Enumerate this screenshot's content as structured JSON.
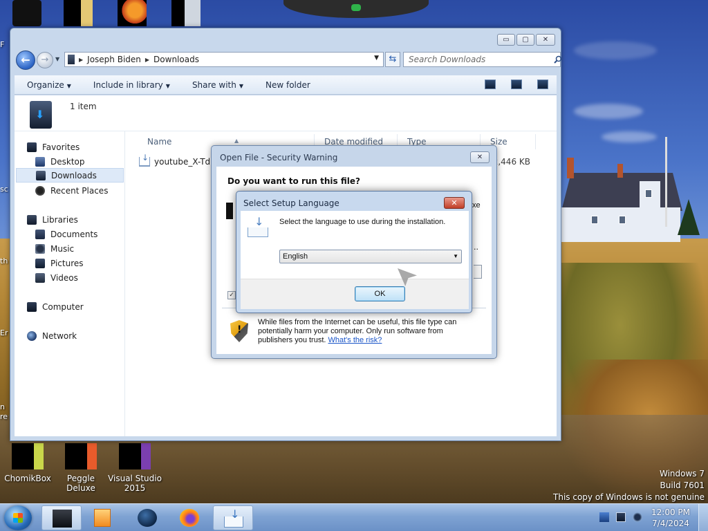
{
  "desktop": {
    "top_icons": [
      "recycle-bin-icon",
      "folder-icon",
      "media-player-icon",
      "file-icon"
    ],
    "side_fragments": [
      "F",
      "sc",
      "th",
      "Er",
      "n",
      "re"
    ],
    "icons": [
      {
        "name": "ChomikBox",
        "glyph": "chomikbox-icon"
      },
      {
        "name": "Peggle Deluxe",
        "glyph": "peggle-icon"
      },
      {
        "name": "Visual Studio 2015",
        "glyph": "visual-studio-icon"
      }
    ],
    "watermark": {
      "line1": "Windows 7",
      "line2": "Build 7601",
      "line3": "This copy of Windows is not genuine"
    }
  },
  "explorer": {
    "controls": {
      "minimize": "▭",
      "maximize": "▢",
      "close": "✕"
    },
    "address": {
      "user": "Joseph Biden",
      "folder": "Downloads"
    },
    "search": {
      "placeholder": "Search Downloads"
    },
    "toolbar": {
      "organize": "Organize",
      "include": "Include in library",
      "share": "Share with",
      "new_folder": "New folder"
    },
    "item_count": "1 item",
    "nav": {
      "favorites": "Favorites",
      "desktop": "Desktop",
      "downloads": "Downloads",
      "recent": "Recent Places",
      "libraries": "Libraries",
      "documents": "Documents",
      "music": "Music",
      "pictures": "Pictures",
      "videos": "Videos",
      "computer": "Computer",
      "network": "Network"
    },
    "columns": {
      "name": "Name",
      "date": "Date modified",
      "type": "Type",
      "size": "Size"
    },
    "file": {
      "name": "youtube_X-TdM",
      "size": "2,446 KB"
    }
  },
  "security": {
    "title": "Open File - Security Warning",
    "close": "✕",
    "question": "Do you want to run this file?",
    "frag_right": "xe",
    "frag_dots": "..",
    "checkbox": "✓",
    "warning": "While files from the Internet can be useful, this file type can potentially harm your computer. Only run software from publishers you trust.",
    "link": "What's the risk?"
  },
  "setup": {
    "title": "Select Setup Language",
    "close": "✕",
    "prompt": "Select the language to use during the installation.",
    "language": "English",
    "ok": "OK"
  },
  "taskbar": {
    "time": "12:00 PM",
    "date": "7/4/2024"
  },
  "colors": {
    "accent": "#2c64c4",
    "close_red": "#c13e27",
    "link": "#1a55c8"
  }
}
